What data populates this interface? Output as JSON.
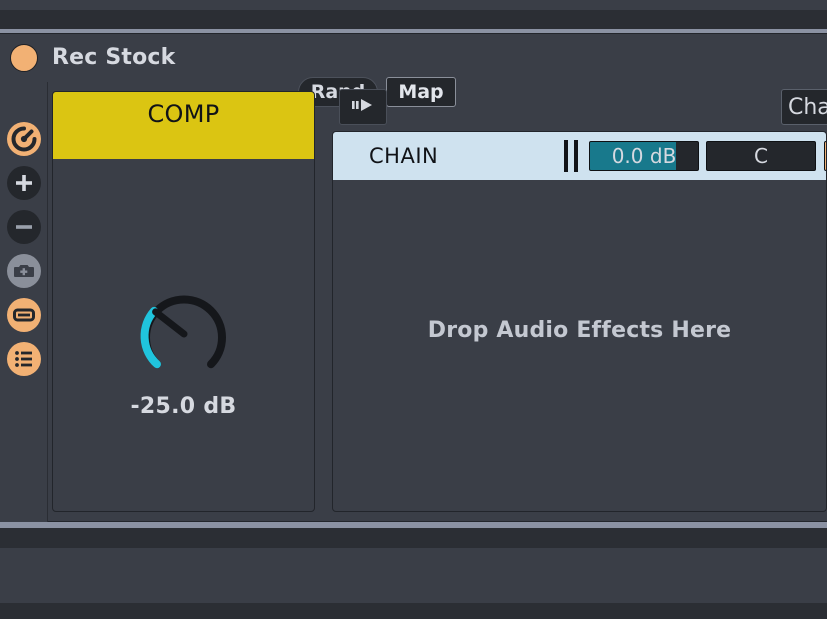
{
  "device": {
    "title": "Rec Stock",
    "color_dot": "#f2b174",
    "buttons": {
      "rand": "Rand",
      "map": "Map"
    }
  },
  "rail": {
    "items": [
      {
        "name": "record-loop-icon",
        "style": "orange"
      },
      {
        "name": "plus-icon",
        "style": "dark"
      },
      {
        "name": "minus-icon",
        "style": "dark"
      },
      {
        "name": "camera-snapshot-icon",
        "style": "grey"
      },
      {
        "name": "macro-view-icon",
        "style": "orange"
      },
      {
        "name": "list-view-icon",
        "style": "orange"
      }
    ]
  },
  "macro": {
    "title": "COMP",
    "header_color": "#dbc512",
    "knob_value": "-25.0 dB",
    "knob_arc_color": "#20c4dd",
    "knob_track_color": "#15171b"
  },
  "chain": {
    "toolbar": {
      "play_icon": "play-pause-icon",
      "chain_button_label": "Chain"
    },
    "row": {
      "name": "CHAIN",
      "volume": "0.0 dB",
      "volume_fill_color": "#18798c",
      "pan": "C",
      "activator_icon": "speaker-icon",
      "activator_color": "#f2b174",
      "row_color": "#cfe2ef"
    },
    "drop_hint": "Drop Audio Effects Here"
  }
}
